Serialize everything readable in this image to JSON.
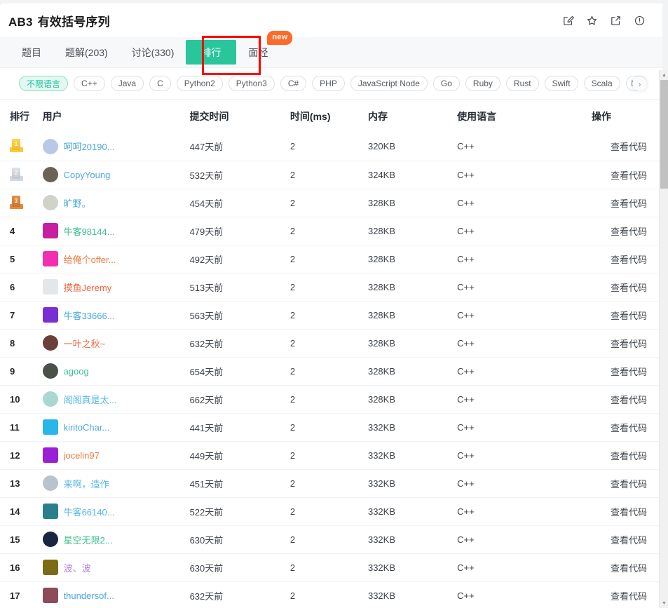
{
  "header": {
    "code": "AB3",
    "title": "有效括号序列",
    "icons": [
      {
        "name": "note-edit-icon",
        "label": "笔记"
      },
      {
        "name": "star-icon",
        "label": "收藏"
      },
      {
        "name": "share-icon",
        "label": "分享"
      },
      {
        "name": "info-icon",
        "label": "反馈"
      }
    ]
  },
  "tabs": [
    {
      "label": "题目",
      "active": false
    },
    {
      "label": "题解(203)",
      "active": false
    },
    {
      "label": "讨论(330)",
      "active": false
    },
    {
      "label": "排行",
      "active": true
    },
    {
      "label": "面经",
      "active": false,
      "badge": "new"
    }
  ],
  "language_filter": {
    "chips": [
      {
        "label": "不限语言",
        "selected": true
      },
      {
        "label": "C++",
        "selected": false
      },
      {
        "label": "Java",
        "selected": false
      },
      {
        "label": "C",
        "selected": false
      },
      {
        "label": "Python2",
        "selected": false
      },
      {
        "label": "Python3",
        "selected": false
      },
      {
        "label": "C#",
        "selected": false
      },
      {
        "label": "PHP",
        "selected": false
      },
      {
        "label": "JavaScript Node",
        "selected": false
      },
      {
        "label": "Go",
        "selected": false
      },
      {
        "label": "Ruby",
        "selected": false
      },
      {
        "label": "Rust",
        "selected": false
      },
      {
        "label": "Swift",
        "selected": false
      },
      {
        "label": "Scala",
        "selected": false
      },
      {
        "label": "Ko",
        "selected": false,
        "clipped": true
      }
    ],
    "next_arrow": "›"
  },
  "table": {
    "columns": [
      "排行",
      "用户",
      "提交时间",
      "时间(ms)",
      "内存",
      "使用语言",
      "操作"
    ],
    "action_label": "查看代码",
    "rows": [
      {
        "rank": "1",
        "medal": "gold",
        "user": "呵呵20190...",
        "color": "#4aa8e0",
        "avatar": "#b9c8e8",
        "shape": "circle",
        "time": "447天前",
        "ms": "2",
        "mem": "320KB",
        "lang": "C++",
        "action": "查看代码"
      },
      {
        "rank": "2",
        "medal": "silver",
        "user": "CopyYoung",
        "color": "#4aa8e0",
        "avatar": "#6b6258",
        "shape": "circle",
        "time": "532天前",
        "ms": "2",
        "mem": "324KB",
        "lang": "C++",
        "action": "查看代码"
      },
      {
        "rank": "3",
        "medal": "bronze",
        "user": "旷野。",
        "color": "#4aa8e0",
        "avatar": "#cfd3c8",
        "shape": "circle",
        "time": "454天前",
        "ms": "2",
        "mem": "328KB",
        "lang": "C++",
        "action": "查看代码"
      },
      {
        "rank": "4",
        "medal": null,
        "user": "牛客98144...",
        "color": "#3fbf8f",
        "avatar": "#c61fa0",
        "shape": "square",
        "time": "479天前",
        "ms": "2",
        "mem": "328KB",
        "lang": "C++",
        "action": "查看代码"
      },
      {
        "rank": "5",
        "medal": null,
        "user": "给俺个offer...",
        "color": "#f07a3c",
        "avatar": "#f22fb0",
        "shape": "square",
        "time": "492天前",
        "ms": "2",
        "mem": "328KB",
        "lang": "C++",
        "action": "查看代码"
      },
      {
        "rank": "6",
        "medal": null,
        "user": "摸鱼Jeremy",
        "color": "#f0653c",
        "avatar": "#e4e7ea",
        "shape": "square",
        "time": "513天前",
        "ms": "2",
        "mem": "328KB",
        "lang": "C++",
        "action": "查看代码"
      },
      {
        "rank": "7",
        "medal": null,
        "user": "牛客33666...",
        "color": "#4aa8e0",
        "avatar": "#7a2fd4",
        "shape": "square",
        "time": "563天前",
        "ms": "2",
        "mem": "328KB",
        "lang": "C++",
        "action": "查看代码"
      },
      {
        "rank": "8",
        "medal": null,
        "user": "一叶之秋~",
        "color": "#f0653c",
        "avatar": "#6b4038",
        "shape": "circle",
        "time": "632天前",
        "ms": "2",
        "mem": "328KB",
        "lang": "C++",
        "action": "查看代码"
      },
      {
        "rank": "9",
        "medal": null,
        "user": "agoog",
        "color": "#3fbf8f",
        "avatar": "#4a5149",
        "shape": "circle",
        "time": "654天前",
        "ms": "2",
        "mem": "328KB",
        "lang": "C++",
        "action": "查看代码"
      },
      {
        "rank": "10",
        "medal": null,
        "user": "阁阁真是太...",
        "color": "#56b7e8",
        "avatar": "#a8d8d0",
        "shape": "circle",
        "time": "662天前",
        "ms": "2",
        "mem": "328KB",
        "lang": "C++",
        "action": "查看代码"
      },
      {
        "rank": "11",
        "medal": null,
        "user": "kiritoChar...",
        "color": "#4aa8e0",
        "avatar": "#29b6e8",
        "shape": "square",
        "time": "441天前",
        "ms": "2",
        "mem": "332KB",
        "lang": "C++",
        "action": "查看代码"
      },
      {
        "rank": "12",
        "medal": null,
        "user": "jocelin97",
        "color": "#f07a3c",
        "avatar": "#9b1fd4",
        "shape": "square",
        "time": "449天前",
        "ms": "2",
        "mem": "332KB",
        "lang": "C++",
        "action": "查看代码"
      },
      {
        "rank": "13",
        "medal": null,
        "user": "来啊，造作",
        "color": "#56b7e8",
        "avatar": "#b9c3cb",
        "shape": "circle",
        "time": "451天前",
        "ms": "2",
        "mem": "332KB",
        "lang": "C++",
        "action": "查看代码"
      },
      {
        "rank": "14",
        "medal": null,
        "user": "牛客66140...",
        "color": "#56b7e8",
        "avatar": "#2a7f8c",
        "shape": "square",
        "time": "522天前",
        "ms": "2",
        "mem": "332KB",
        "lang": "C++",
        "action": "查看代码"
      },
      {
        "rank": "15",
        "medal": null,
        "user": "星空无限2...",
        "color": "#3fbf8f",
        "avatar": "#1a2540",
        "shape": "circle",
        "time": "630天前",
        "ms": "2",
        "mem": "332KB",
        "lang": "C++",
        "action": "查看代码"
      },
      {
        "rank": "16",
        "medal": null,
        "user": "波、波",
        "color": "#b07ce0",
        "avatar": "#7d6a14",
        "shape": "square",
        "time": "630天前",
        "ms": "2",
        "mem": "332KB",
        "lang": "C++",
        "action": "查看代码"
      },
      {
        "rank": "17",
        "medal": null,
        "user": "thundersof...",
        "color": "#4aa8e0",
        "avatar": "#8d4a58",
        "shape": "square",
        "time": "632天前",
        "ms": "2",
        "mem": "332KB",
        "lang": "C++",
        "action": "查看代码"
      }
    ]
  },
  "colors": {
    "accent_green": "#29c69c",
    "badge_orange": "#ff6a28",
    "annotation_red": "#fe0000",
    "chip_selected_bg": "#e3f8f1",
    "chip_selected_text": "#14c09a"
  }
}
